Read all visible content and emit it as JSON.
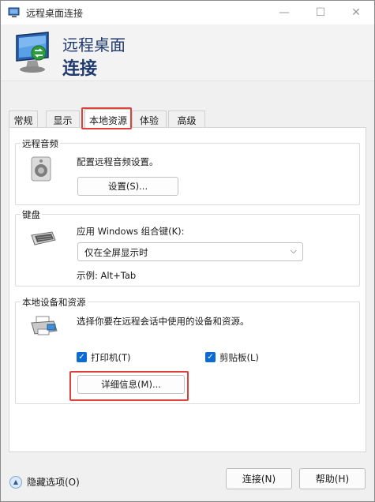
{
  "window": {
    "title": "远程桌面连接",
    "minimize_icon": "—",
    "maximize_icon": "☐",
    "close_icon": "✕"
  },
  "banner": {
    "line1": "远程桌面",
    "line2": "连接"
  },
  "tabs": [
    {
      "label": "常规"
    },
    {
      "label": "显示"
    },
    {
      "label": "本地资源",
      "active": true
    },
    {
      "label": "体验"
    },
    {
      "label": "高级"
    }
  ],
  "remote_audio": {
    "group_title": "远程音频",
    "description": "配置远程音频设置。",
    "settings_button": "设置(S)..."
  },
  "keyboard": {
    "group_title": "键盘",
    "apply_label": "应用 Windows 组合键(K):",
    "selected_option": "仅在全屏显示时",
    "example": "示例: Alt+Tab"
  },
  "local_devices": {
    "group_title": "本地设备和资源",
    "description": "选择你要在远程会话中使用的设备和资源。",
    "printer_label": "打印机(T)",
    "printer_checked": true,
    "clipboard_label": "剪贴板(L)",
    "clipboard_checked": true,
    "more_button": "详细信息(M)..."
  },
  "footer": {
    "hide_options": "隐藏选项(O)",
    "connect_button": "连接(N)",
    "help_button": "帮助(H)"
  },
  "colors": {
    "accent": "#0c6bd2",
    "highlight": "#e0403a",
    "banner_text": "#1f3a6e"
  }
}
